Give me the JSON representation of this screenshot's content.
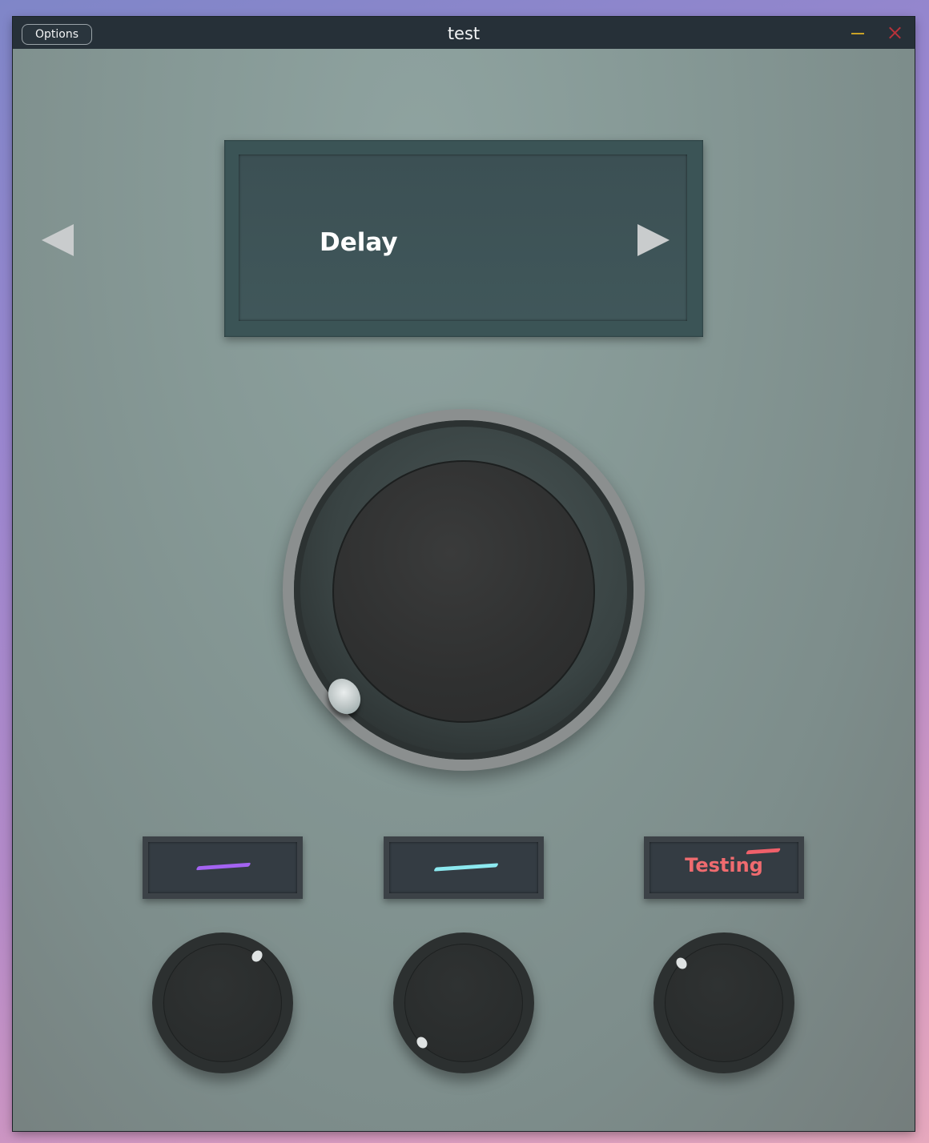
{
  "window": {
    "title": "test",
    "options_label": "Options"
  },
  "display": {
    "preset_name": "Delay"
  },
  "mini_displays": [
    {
      "label": "",
      "accent_color": "#a463f2"
    },
    {
      "label": "",
      "accent_color": "#8ce9f0"
    },
    {
      "label": "Testing",
      "accent_color": "#f0606a"
    }
  ],
  "colors": {
    "titlebar": "#263038",
    "panel": "#869996",
    "display": "#3b5456",
    "minimize": "#c9a227",
    "close": "#b8323a"
  },
  "icons": [
    "minimize-icon",
    "close-icon",
    "arrow-left-icon",
    "arrow-right-icon"
  ]
}
